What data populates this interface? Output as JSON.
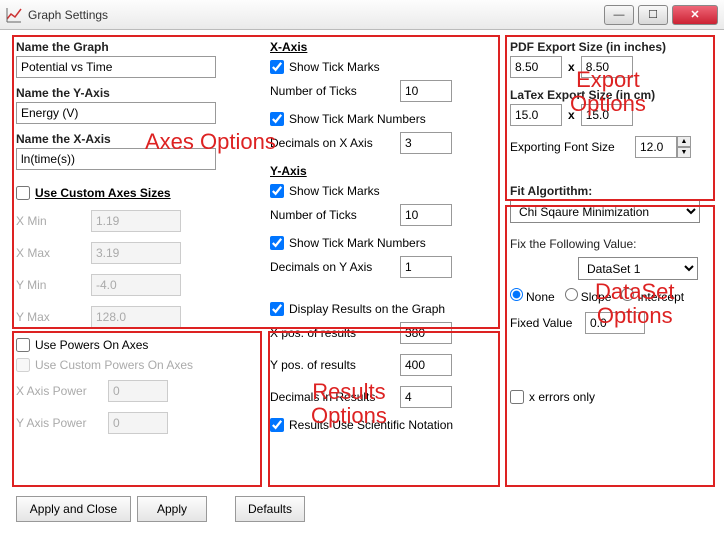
{
  "window": {
    "title": "Graph Settings"
  },
  "axes": {
    "name_graph_label": "Name the Graph",
    "name_graph": "Potential vs Time",
    "name_y_label": "Name the Y-Axis",
    "name_y": "Energy (V)",
    "name_x_label": "Name the X-Axis",
    "name_x": "ln(time(s))",
    "use_custom_sizes_label": "Use Custom Axes Sizes",
    "xmin_label": "X Min",
    "xmin": "1.19",
    "xmax_label": "X Max",
    "xmax": "3.19",
    "ymin_label": "Y Min",
    "ymin": "-4.0",
    "ymax_label": "Y Max",
    "ymax": "128.0",
    "use_powers_label": "Use Powers On Axes",
    "use_custom_powers_label": "Use Custom Powers On Axes",
    "x_power_label": "X Axis Power",
    "x_power": "0",
    "y_power_label": "Y Axis Power",
    "y_power": "0"
  },
  "xaxis": {
    "head": "X-Axis",
    "show_ticks_label": "Show Tick Marks",
    "num_ticks_label": "Number of Ticks",
    "num_ticks": "10",
    "show_tick_nums_label": "Show Tick Mark Numbers",
    "decimals_label": "Decimals on X Axis",
    "decimals": "3"
  },
  "yaxis": {
    "head": "Y-Axis",
    "show_ticks_label": "Show Tick Marks",
    "num_ticks_label": "Number of Ticks",
    "num_ticks": "10",
    "show_tick_nums_label": "Show Tick Mark Numbers",
    "decimals_label": "Decimals on Y Axis",
    "decimals": "1"
  },
  "results": {
    "display_label": "Display Results on the Graph",
    "xpos_label": "X pos. of results",
    "xpos": "380",
    "ypos_label": "Y pos. of results",
    "ypos": "400",
    "decimals_label": "Decimals in Results",
    "decimals": "4",
    "sci_label": "Results Use Scientific Notation"
  },
  "export": {
    "pdf_label": "PDF Export Size (in inches)",
    "pdf_w": "8.50",
    "pdf_h": "8.50",
    "x": "x",
    "latex_label": "LaTex Export Size (in cm)",
    "latex_w": "15.0",
    "latex_h": "15.0",
    "font_label": "Exporting Font Size",
    "font": "12.0"
  },
  "dataset": {
    "fit_algo_label": "Fit Algortithm:",
    "fit_algo": "Chi Sqaure Minimization",
    "fix_label": "Fix the Following Value:",
    "dataset_sel": "DataSet 1",
    "none": "None",
    "slope": "Slope",
    "intercept": "Intercept",
    "fixed_label": "Fixed Value",
    "fixed": "0.0",
    "xerrors_label": "x errors only"
  },
  "buttons": {
    "apply_close": "Apply and Close",
    "apply": "Apply",
    "defaults": "Defaults"
  },
  "overlays": {
    "axes": "Axes Options",
    "results": "Results\nOptions",
    "export": "Export\nOptions",
    "dataset": "DataSet\nOptions"
  }
}
